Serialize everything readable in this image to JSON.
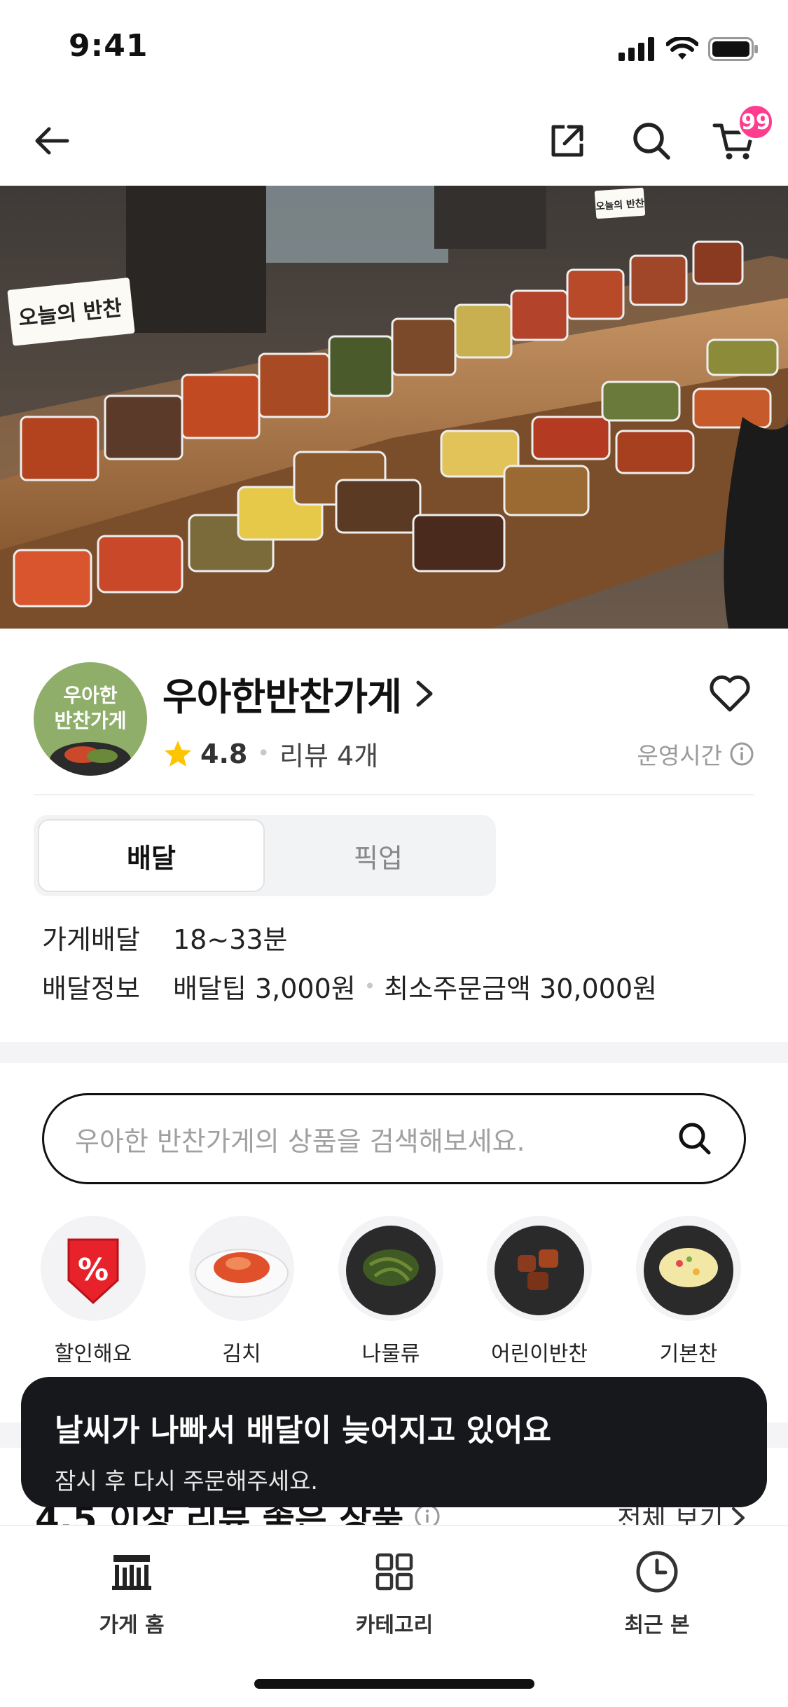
{
  "status_bar": {
    "time": "9:41"
  },
  "nav": {
    "cart_badge": "99"
  },
  "store": {
    "logo_text_line1": "우아한",
    "logo_text_line2": "반찬가게",
    "name": "우아한반찬가게",
    "rating": "4.8",
    "review_count": "리뷰 4개",
    "hours_label": "운영시간"
  },
  "hero_signs": {
    "left": "오늘의 반찬",
    "right": "오늘의 반찬"
  },
  "delivery_toggle": {
    "options": [
      "배달",
      "픽업"
    ],
    "selected": "배달"
  },
  "info": {
    "store_delivery_label": "가게배달",
    "store_delivery_value": "18~33분",
    "delivery_info_label": "배달정보",
    "delivery_tip": "배달팁 3,000원",
    "min_order": "최소주문금액 30,000원"
  },
  "search": {
    "placeholder": "우아한 반찬가게의 상품을 검색해보세요."
  },
  "categories": [
    {
      "label": "할인해요",
      "icon": "discount-icon"
    },
    {
      "label": "김치",
      "icon": "kimchi-icon"
    },
    {
      "label": "나물류",
      "icon": "namul-icon"
    },
    {
      "label": "어린이반찬",
      "icon": "kids-dish-icon"
    },
    {
      "label": "기본찬",
      "icon": "basic-dish-icon"
    }
  ],
  "next_section": {
    "title": "4.5 이상 리뷰 좋은 상품",
    "more": "전체 보기"
  },
  "toast": {
    "title": "날씨가 나빠서 배달이 늦어지고 있어요",
    "subtitle": "잠시 후 다시 주문해주세요."
  },
  "tab_bar": {
    "tabs": [
      {
        "label": "가게 홈",
        "icon": "store-icon"
      },
      {
        "label": "카테고리",
        "icon": "grid-icon"
      },
      {
        "label": "최근 본",
        "icon": "clock-icon"
      }
    ]
  },
  "colors": {
    "badge": "#ff3c8e",
    "star": "#ffc400",
    "toast_bg": "#17181b"
  }
}
